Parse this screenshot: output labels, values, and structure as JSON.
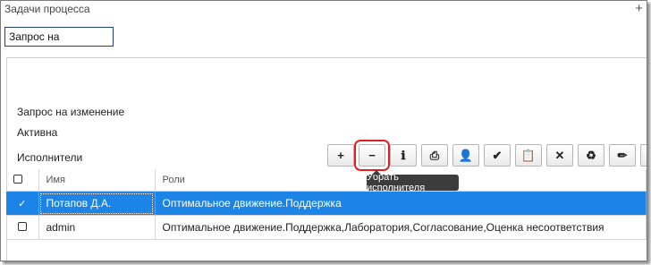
{
  "panel_title": "Задачи процесса",
  "search": {
    "value": "Запрос на"
  },
  "details": {
    "name": "Запрос на изменение",
    "status": "Активна",
    "executors_label": "Исполнители"
  },
  "toolbar": {
    "buttons": [
      {
        "icon": "plus-icon",
        "glyph": "+"
      },
      {
        "icon": "minus-icon",
        "glyph": "−",
        "highlighted": true
      },
      {
        "icon": "info-icon",
        "glyph": "ℹ"
      },
      {
        "icon": "print-icon",
        "glyph": "⎙"
      },
      {
        "icon": "add-user-icon",
        "glyph": "👤"
      },
      {
        "icon": "check-icon",
        "glyph": "✔"
      },
      {
        "icon": "paste-icon",
        "glyph": "📋"
      },
      {
        "icon": "delete-icon",
        "glyph": "✕"
      },
      {
        "icon": "recycle-icon",
        "glyph": "♻"
      },
      {
        "icon": "edit-icon",
        "glyph": "✏"
      },
      {
        "icon": "more-icon",
        "glyph": "⋯"
      }
    ],
    "tooltip": "Убрать исполнителя"
  },
  "table": {
    "columns": [
      "Имя",
      "Роли"
    ],
    "rows": [
      {
        "name": "Потапов Д.А.",
        "roles": "Оптимальное движение.Поддержка",
        "selected": true
      },
      {
        "name": "admin",
        "roles": "Оптимальное движение.Поддержка,Лаборатория,Согласование,Оценка несоответствия",
        "selected": false
      }
    ]
  },
  "colors": {
    "selection": "#1b84e6",
    "highlight": "#e02020",
    "search_border": "#1e3f8a"
  }
}
